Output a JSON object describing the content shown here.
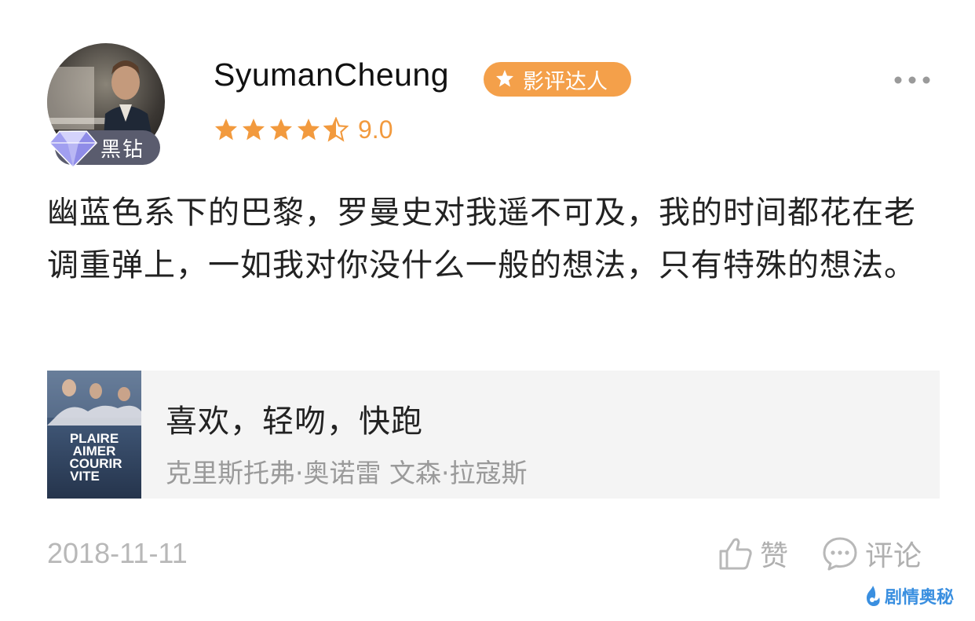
{
  "user": {
    "name": "SyumanCheung",
    "level_badge": "黑钻",
    "critic_badge": "影评达人",
    "rating": "9.0",
    "stars": 4.5
  },
  "review": {
    "text": "幽蓝色系下的巴黎，罗曼史对我遥不可及，我的时间都花在老调重弹上，一如我对你没什么一般的想法，只有特殊的想法。"
  },
  "movie": {
    "title": "喜欢，轻吻，快跑",
    "actors": "克里斯托弗·奥诺雷 文森·拉寇斯",
    "poster_text": [
      "PLAIRE",
      "AIMER",
      "COURIR",
      "VITE"
    ]
  },
  "footer": {
    "date": "2018-11-11",
    "like_label": "赞",
    "comment_label": "评论"
  },
  "watermark": "剧情奥秘",
  "colors": {
    "accent_orange": "#f4a04a",
    "star_color": "#f29a3e",
    "level_badge_bg": "#5a5c6e",
    "card_bg": "#f4f4f4"
  }
}
